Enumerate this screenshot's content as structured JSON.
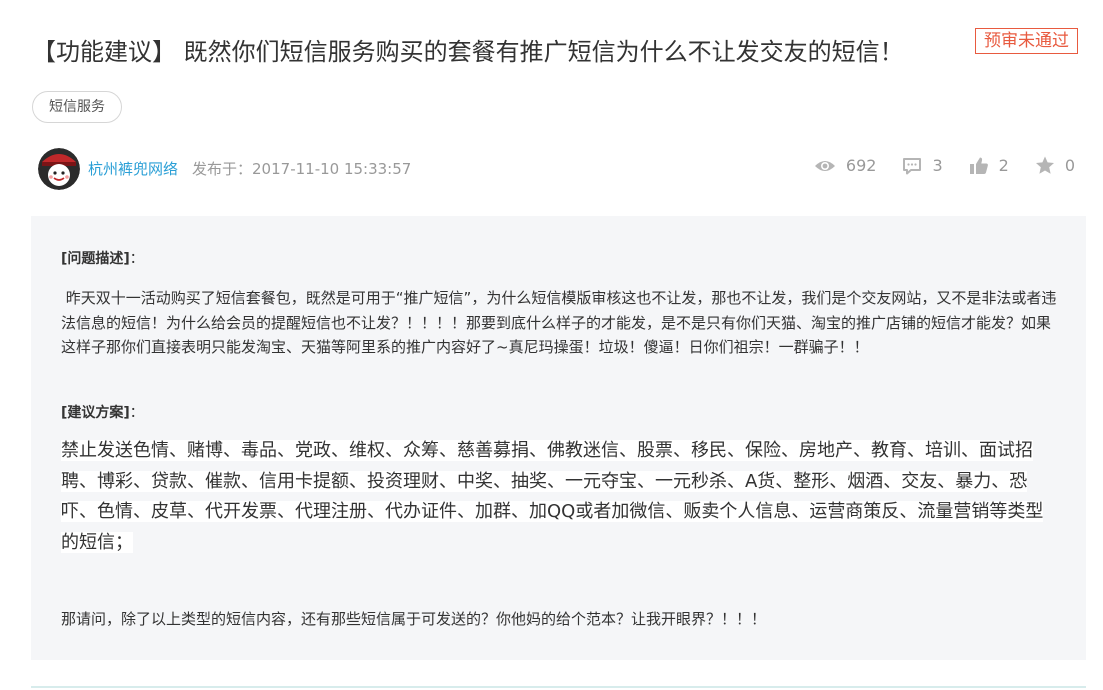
{
  "post": {
    "title": "【功能建议】 既然你们短信服务购买的套餐有推广短信为什么不让发交友的短信！",
    "status": "预审未通过",
    "tag": "短信服务",
    "author": "杭州裤兜网络",
    "posted_label": "发布于：",
    "posted_at": "2017-11-10 15:33:57"
  },
  "stats": {
    "views": "692",
    "comments": "3",
    "likes": "2",
    "favorites": "0"
  },
  "content": {
    "problem_label": "[问题描述]",
    "problem_suffix": "：",
    "problem_text": "昨天双十一活动购买了短信套餐包，既然是可用于“推广短信”，为什么短信模版审核这也不让发，那也不让发，我们是个交友网站，又不是非法或者违法信息的短信！为什么给会员的提醒短信也不让发？！！！！那要到底什么样子的才能发，是不是只有你们天猫、淘宝的推广店铺的短信才能发？如果这样子那你们直接表明只能发淘宝、天猫等阿里系的推广内容好了~真尼玛操蛋！垃圾！傻逼！日你们祖宗！一群骗子！！",
    "proposal_label": "[建议方案]",
    "proposal_suffix": "：",
    "proposal_text": "禁止发送色情、赌博、毒品、党政、维权、众筹、慈善募捐、佛教迷信、股票、移民、保险、房地产、教育、培训、面试招聘、博彩、贷款、催款、信用卡提额、投资理财、中奖、抽奖、一元夺宝、一元秒杀、A货、整形、烟酒、交友、暴力、恐吓、色情、皮草、代开发票、代理注册、代办证件、加群、加QQ或者加微信、贩卖个人信息、运营商策反、流量营销等类型的短信；",
    "question_text": "那请问，除了以上类型的短信内容，还有那些短信属于可发送的？你他妈的给个范本？让我开眼界？！！！"
  },
  "colors": {
    "accent": "#2a9fd6",
    "status": "#e85a3f",
    "panel": "#f5f6f8"
  },
  "icons": [
    "eye-icon",
    "comment-icon",
    "thumbs-up-icon",
    "star-icon"
  ]
}
